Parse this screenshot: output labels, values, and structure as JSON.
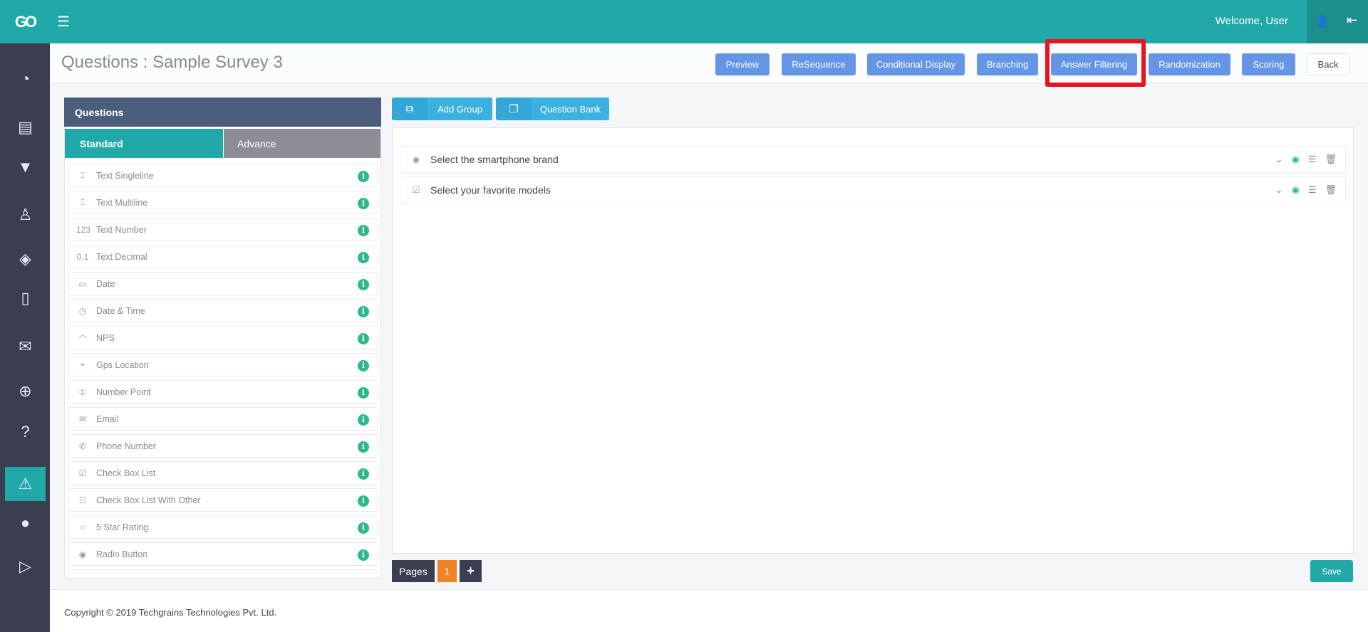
{
  "topbar": {
    "logo": "GO",
    "welcome": "Welcome, User",
    "icons": [
      "menu-icon",
      "user-icon",
      "logout-icon"
    ]
  },
  "sidebar": {
    "items": [
      {
        "icon": "dashboard-icon",
        "glyph": "◔"
      },
      {
        "icon": "book-icon",
        "glyph": "▤"
      },
      {
        "icon": "filter-icon",
        "glyph": "▼"
      },
      {
        "icon": "user-icon",
        "glyph": "♙"
      },
      {
        "icon": "layers-icon",
        "glyph": "◈"
      },
      {
        "icon": "tablet-icon",
        "glyph": "▯"
      },
      {
        "icon": "chat-icon",
        "glyph": "✉"
      },
      {
        "icon": "lifebuoy-icon",
        "glyph": "⊕"
      },
      {
        "icon": "question-icon",
        "glyph": "?"
      },
      {
        "icon": "warning-icon",
        "glyph": "⚠",
        "active": true
      },
      {
        "icon": "apple-icon",
        "glyph": "●"
      },
      {
        "icon": "play-store-icon",
        "glyph": "▷"
      }
    ]
  },
  "header": {
    "title": "Questions : Sample Survey 3",
    "buttons": [
      "Preview",
      "ReSequence",
      "Conditional Display",
      "Branching",
      "Answer Filtering",
      "Randomization",
      "Scoring",
      "Back"
    ],
    "highlighted": "Answer Filtering",
    "highlight_color": "#e8141e"
  },
  "left_panel": {
    "title": "Questions",
    "tabs": [
      "Standard",
      "Advance"
    ],
    "active_tab": "Standard",
    "items": [
      {
        "label": "Text Singleline",
        "glyph": "⌶"
      },
      {
        "label": "Text Multiline",
        "glyph": "⌶"
      },
      {
        "label": "Text Number",
        "glyph": "123"
      },
      {
        "label": "Text Decimal",
        "glyph": "0.1"
      },
      {
        "label": "Date",
        "glyph": "▭"
      },
      {
        "label": "Date & Time",
        "glyph": "◷"
      },
      {
        "label": "NPS",
        "glyph": "◠"
      },
      {
        "label": "Gps Location",
        "glyph": "⌖"
      },
      {
        "label": "Number Point",
        "glyph": "①"
      },
      {
        "label": "Email",
        "glyph": "✉"
      },
      {
        "label": "Phone Number",
        "glyph": "✆"
      },
      {
        "label": "Check Box List",
        "glyph": "☑"
      },
      {
        "label": "Check Box List With Other",
        "glyph": "☷"
      },
      {
        "label": "5 Star Rating",
        "glyph": "☆"
      },
      {
        "label": "Radio Button",
        "glyph": "◉"
      },
      {
        "label": "",
        "glyph": ""
      }
    ]
  },
  "actions": {
    "add_group": "Add Group",
    "question_bank": "Question Bank"
  },
  "questions": [
    {
      "text": "Select the smartphone brand",
      "type_glyph": "◉"
    },
    {
      "text": "Select your favorite models",
      "type_glyph": "☑"
    }
  ],
  "pager": {
    "label": "Pages",
    "current": "1",
    "add": "+"
  },
  "save": "Save",
  "footer": {
    "copyright": "Copyright © 2019 Techgrains Technologies Pvt. Ltd."
  },
  "colors": {
    "primary": "#21a8a8",
    "button": "#6495e6",
    "sidebar": "#3b3e51",
    "accent": "#f08225",
    "info": "#2db88e"
  }
}
